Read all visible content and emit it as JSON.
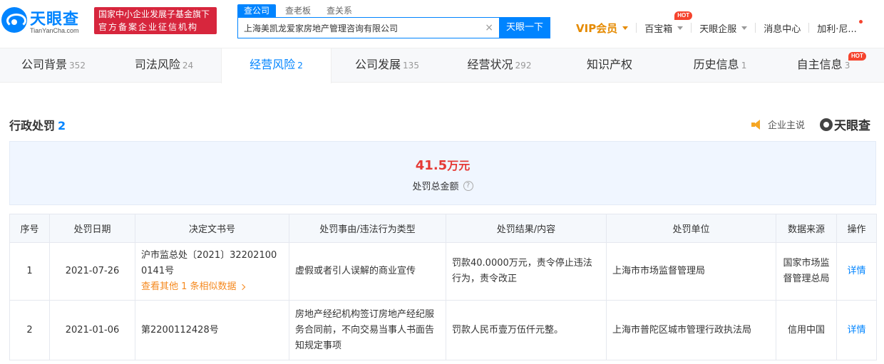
{
  "header": {
    "logo_text": "天眼查",
    "logo_sub": "TianYanCha.com",
    "gov_badge_line1": "国家中小企业发展子基金旗下",
    "gov_badge_line2": "官方备案企业征信机构",
    "search_tabs": [
      "查公司",
      "查老板",
      "查关系"
    ],
    "search_value": "上海美凯龙爱家房地产管理咨询有限公司",
    "search_clear": "×",
    "search_button": "天眼一下",
    "nav": {
      "vip": "VIP会员",
      "baibaoxiang": "百宝箱",
      "hot": "HOT",
      "qifu": "天眼企服",
      "messages": "消息中心",
      "user": "加利·尼..."
    }
  },
  "tabs": [
    {
      "label": "公司背景",
      "count": "352"
    },
    {
      "label": "司法风险",
      "count": "24"
    },
    {
      "label": "经营风险",
      "count": "2"
    },
    {
      "label": "公司发展",
      "count": "135"
    },
    {
      "label": "经营状况",
      "count": "292"
    },
    {
      "label": "知识产权",
      "count": ""
    },
    {
      "label": "历史信息",
      "count": "1"
    },
    {
      "label": "自主信息",
      "count": "3"
    }
  ],
  "tab_hot": "HOT",
  "section": {
    "title": "行政处罚",
    "count": "2",
    "enterprise_say": "企业主说",
    "watermark": "天眼查"
  },
  "summary": {
    "amount": "41.5",
    "unit": "万元",
    "label": "处罚总金额",
    "help": "?"
  },
  "table": {
    "headers": [
      "序号",
      "处罚日期",
      "决定文书号",
      "处罚事由/违法行为类型",
      "处罚结果/内容",
      "处罚单位",
      "数据来源",
      "操作"
    ],
    "rows": [
      {
        "no": "1",
        "date": "2021-07-26",
        "doc_line1": "沪市监总处〔2021〕32202100",
        "doc_line2": "0141号",
        "more": "查看其他 1 条相似数据",
        "reason": "虚假或者引人误解的商业宣传",
        "result": "罚款40.0000万元，责令停止违法行为，责令改正",
        "authority": "上海市市场监督管理局",
        "source": "国家市场监督管理总局",
        "action": "详情"
      },
      {
        "no": "2",
        "date": "2021-01-06",
        "doc_line1": "第2200112428号",
        "reason": "房地产经纪机构签订房地产经纪服务合同前，不向交易当事人书面告知规定事项",
        "result": "罚款人民币壹万伍仟元整。",
        "authority": "上海市普陀区城市管理行政执法局",
        "source": "信用中国",
        "action": "详情"
      }
    ]
  },
  "colors": {
    "brand": "#0084ff",
    "vip": "#e58a00",
    "alert": "#e53935",
    "more_link": "#f5891f",
    "gov_badge": "#d7263d"
  }
}
